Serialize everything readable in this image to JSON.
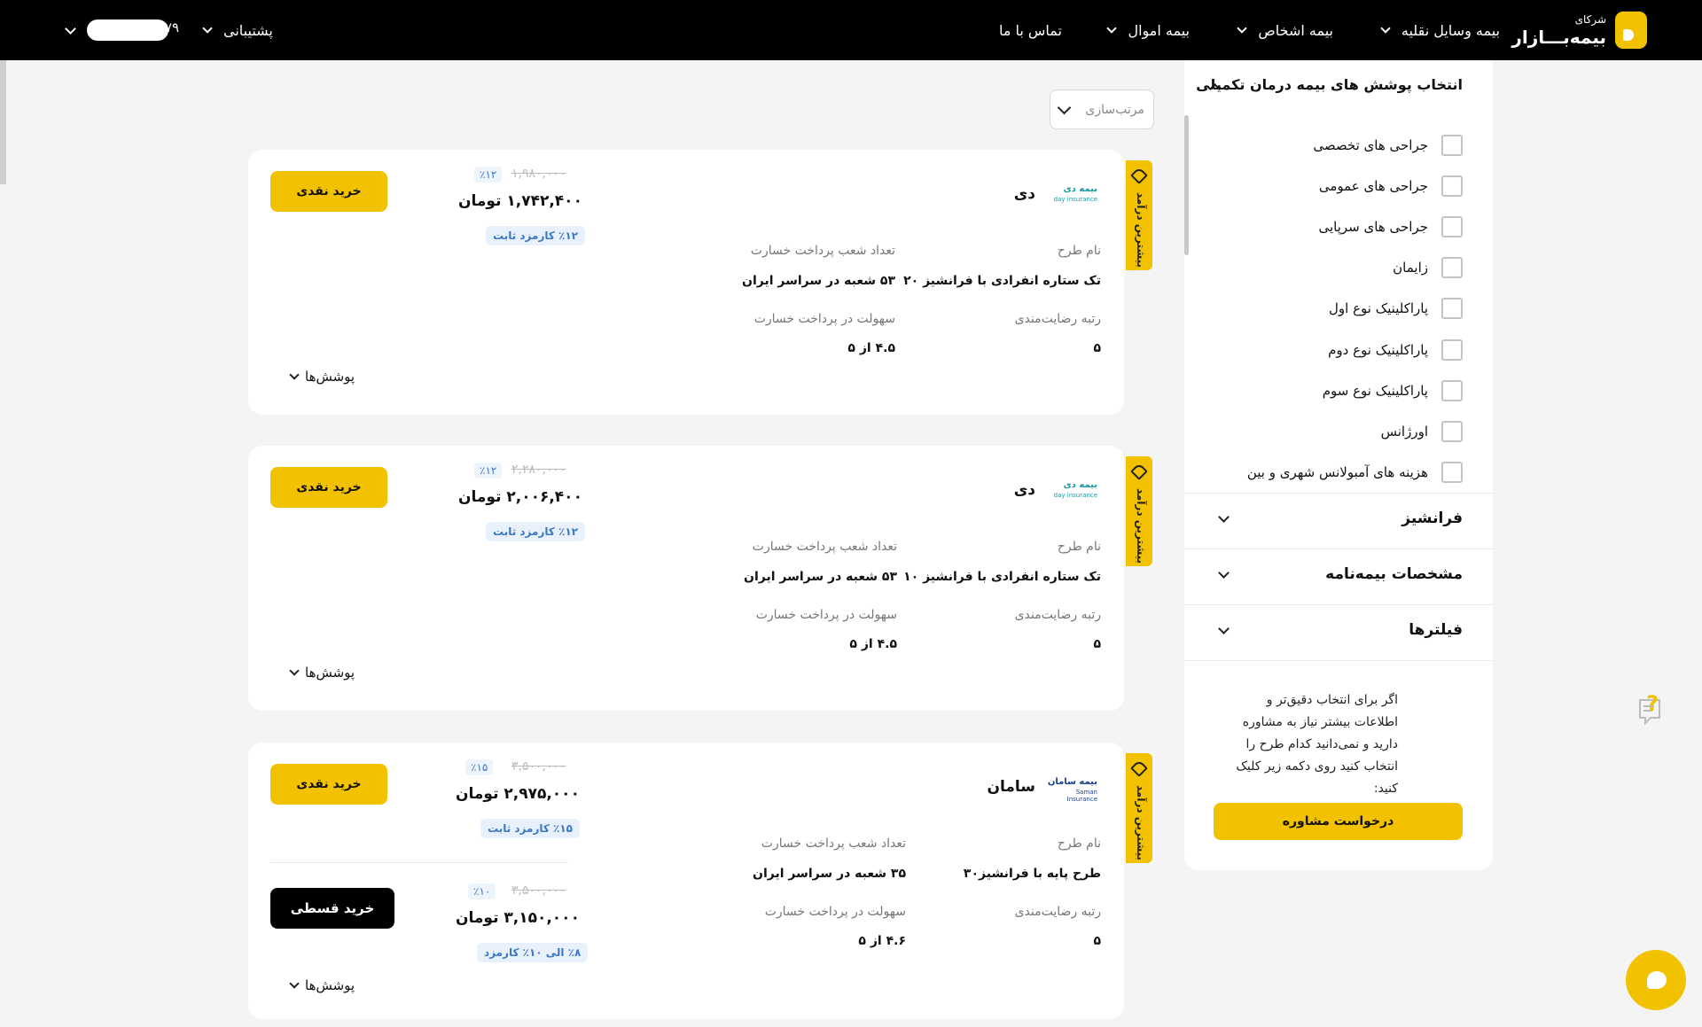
{
  "header": {
    "logo_small": "شرکای",
    "logo_big": "بیمه‌بـــازار",
    "nav": [
      {
        "label": "بیمه وسایل نقلیه"
      },
      {
        "label": "بیمه اشخاص"
      },
      {
        "label": "بیمه اموال"
      },
      {
        "label": "تماس با ما"
      }
    ],
    "support": "پشتیبانی",
    "user_suffix": "۷۹"
  },
  "sort": {
    "label": "مرتب‌سازی"
  },
  "cards": [
    {
      "tag": "بیشترین درآمد",
      "insurer": "دی",
      "logo_text": "بیمه دی",
      "logo_sub": "day insurance",
      "plan_label": "نام طرح",
      "plan": "تک ستاره انفرادی با فرانشیز ۲۰",
      "branches_label": "تعداد شعب پرداخت خسارت",
      "branches": "۵۳ شعبه در سراسر ایران",
      "satisfaction_label": "رتبه رضایت‌مندی",
      "satisfaction": "۵",
      "ease_label": "سهولت در پرداخت خسارت",
      "ease": "۴.۵ از ۵",
      "old_price": "۱,۹۸۰,۰۰۰",
      "discount": "٪۱۲",
      "price": "۱,۷۴۲,۴۰۰ تومان",
      "commission": "٪۱۲ کارمزد ثابت",
      "buy_cash": "خرید نقدی",
      "coverages": "پوشش‌ها"
    },
    {
      "tag": "بیشترین درآمد",
      "insurer": "دی",
      "logo_text": "بیمه دی",
      "logo_sub": "day insurance",
      "plan_label": "نام طرح",
      "plan": "تک ستاره انفرادی با فرانشیز ۱۰",
      "branches_label": "تعداد شعب پرداخت خسارت",
      "branches": "۵۳ شعبه در سراسر ایران",
      "satisfaction_label": "رتبه رضایت‌مندی",
      "satisfaction": "۵",
      "ease_label": "سهولت در پرداخت خسارت",
      "ease": "۴.۵ از ۵",
      "old_price": "۲,۲۸۰,۰۰۰",
      "discount": "٪۱۲",
      "price": "۲,۰۰۶,۴۰۰ تومان",
      "commission": "٪۱۲ کارمزد ثابت",
      "buy_cash": "خرید نقدی",
      "coverages": "پوشش‌ها"
    },
    {
      "tag": "بیشترین درآمد",
      "insurer": "سامان",
      "logo_text": "بیمه سامان",
      "logo_sub": "Saman Insurance",
      "plan_label": "نام طرح",
      "plan": "طرح پایه با فرانشیز۳۰",
      "branches_label": "تعداد شعب پرداخت خسارت",
      "branches": "۳۵ شعبه در سراسر ایران",
      "satisfaction_label": "رتبه رضایت‌مندی",
      "satisfaction": "۵",
      "ease_label": "سهولت در پرداخت خسارت",
      "ease": "۴.۶ از ۵",
      "old_price": "۳,۵۰۰,۰۰۰",
      "discount": "٪۱۵",
      "price": "۲,۹۷۵,۰۰۰ تومان",
      "commission": "٪۱۵ کارمزد ثابت",
      "buy_cash": "خرید نقدی",
      "inst_old_price": "۳,۵۰۰,۰۰۰",
      "inst_discount": "٪۱۰",
      "inst_price": "۳,۱۵۰,۰۰۰ تومان",
      "inst_commission": "٪۸ الی ۱۰٪ کارمزد",
      "buy_installment": "خرید قسطی",
      "coverages": "پوشش‌ها"
    }
  ],
  "sidebar": {
    "title": "انتخاب پوشش های بیمه درمان تکمیلی",
    "options": [
      {
        "label": "جراحی های تخصصی"
      },
      {
        "label": "جراحی های عمومی"
      },
      {
        "label": "جراحی های سرپایی"
      },
      {
        "label": "زایمان"
      },
      {
        "label": "پاراکلینیک نوع اول"
      },
      {
        "label": "پاراکلینیک نوع دوم"
      },
      {
        "label": "پاراکلینیک نوع سوم"
      },
      {
        "label": "اورژانس"
      },
      {
        "label": "هزینه های آمبولانس شهری و بین"
      }
    ],
    "sections": [
      {
        "label": "فرانشیز"
      },
      {
        "label": "مشخصات بیمه‌نامه"
      },
      {
        "label": "فیلترها"
      }
    ],
    "advice_text": "اگر برای انتخاب دقیق‌تر و اطلاعات بیشتر نیاز به مشاوره دارید و نمی‌دانید کدام طرح را انتخاب کنید روی دکمه زیر کلیک کنید:",
    "advice_button": "درخواست مشاوره"
  },
  "colors": {
    "accent": "#f2c200",
    "header_bg": "#000000",
    "link_blue": "#3b78c4"
  }
}
